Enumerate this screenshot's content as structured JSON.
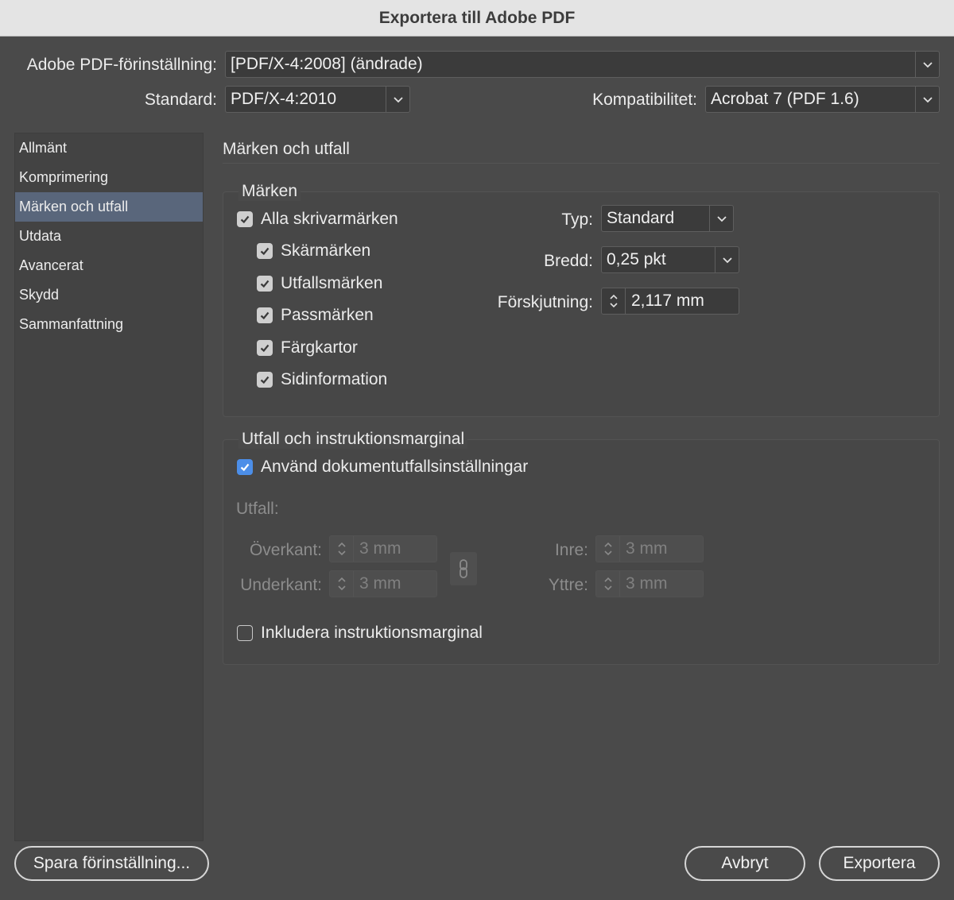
{
  "window": {
    "title": "Exportera till Adobe PDF"
  },
  "top": {
    "preset_label": "Adobe PDF-förinställning:",
    "preset_value": "[PDF/X-4:2008] (ändrade)",
    "standard_label": "Standard:",
    "standard_value": "PDF/X-4:2010",
    "compat_label": "Kompatibilitet:",
    "compat_value": "Acrobat 7 (PDF 1.6)"
  },
  "sidebar": {
    "items": [
      {
        "label": "Allmänt"
      },
      {
        "label": "Komprimering"
      },
      {
        "label": "Märken och utfall",
        "selected": true
      },
      {
        "label": "Utdata"
      },
      {
        "label": "Avancerat"
      },
      {
        "label": "Skydd"
      },
      {
        "label": "Sammanfattning"
      }
    ]
  },
  "content": {
    "title": "Märken och utfall",
    "marks": {
      "title": "Märken",
      "all_printer_marks": {
        "label": "Alla skrivarmärken",
        "checked": true
      },
      "options": [
        {
          "label": "Skärmärken",
          "checked": true
        },
        {
          "label": "Utfallsmärken",
          "checked": true
        },
        {
          "label": "Passmärken",
          "checked": true
        },
        {
          "label": "Färgkartor",
          "checked": true
        },
        {
          "label": "Sidinformation",
          "checked": true
        }
      ],
      "type_label": "Typ:",
      "type_value": "Standard",
      "width_label": "Bredd:",
      "width_value": "0,25 pkt",
      "offset_label": "Förskjutning:",
      "offset_value": "2,117 mm"
    },
    "bleed": {
      "title": "Utfall och instruktionsmarginal",
      "use_doc": {
        "label": "Använd dokumentutfallsinställningar",
        "checked": true
      },
      "bleed_label": "Utfall:",
      "top_label": "Överkant:",
      "top_value": "3 mm",
      "bottom_label": "Underkant:",
      "bottom_value": "3 mm",
      "inner_label": "Inre:",
      "inner_value": "3 mm",
      "outer_label": "Yttre:",
      "outer_value": "3 mm",
      "include_slug": {
        "label": "Inkludera instruktionsmarginal",
        "checked": false
      }
    }
  },
  "footer": {
    "save_preset": "Spara förinställning...",
    "cancel": "Avbryt",
    "export": "Exportera"
  },
  "colors": {
    "selection": "#59667b",
    "checkbox_accent": "#4c8ee8"
  }
}
